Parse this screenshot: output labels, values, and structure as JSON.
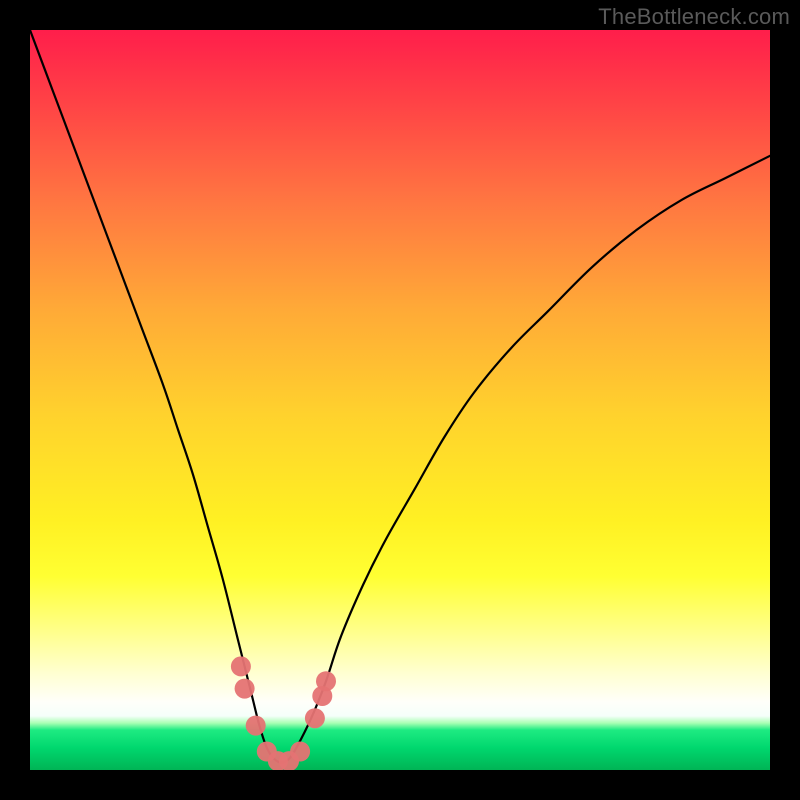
{
  "watermark": "TheBottleneck.com",
  "chart_data": {
    "type": "line",
    "title": "",
    "xlabel": "",
    "ylabel": "",
    "xlim": [
      0,
      100
    ],
    "ylim": [
      0,
      100
    ],
    "series": [
      {
        "name": "bottleneck-curve",
        "x": [
          0,
          3,
          6,
          9,
          12,
          15,
          18,
          20,
          22,
          24,
          26,
          28,
          30,
          31,
          32,
          33,
          34,
          35,
          36,
          38,
          40,
          42,
          45,
          48,
          52,
          56,
          60,
          65,
          70,
          76,
          82,
          88,
          94,
          100
        ],
        "y": [
          100,
          92,
          84,
          76,
          68,
          60,
          52,
          46,
          40,
          33,
          26,
          18,
          10,
          6,
          3,
          1.5,
          1,
          1.5,
          3,
          7,
          12,
          18,
          25,
          31,
          38,
          45,
          51,
          57,
          62,
          68,
          73,
          77,
          80,
          83
        ]
      }
    ],
    "markers": {
      "name": "highlighted-points",
      "points": [
        {
          "x": 28.5,
          "y": 14
        },
        {
          "x": 29.0,
          "y": 11
        },
        {
          "x": 30.5,
          "y": 6
        },
        {
          "x": 32.0,
          "y": 2.5
        },
        {
          "x": 33.5,
          "y": 1.2
        },
        {
          "x": 35.0,
          "y": 1.2
        },
        {
          "x": 36.5,
          "y": 2.5
        },
        {
          "x": 38.5,
          "y": 7
        },
        {
          "x": 39.5,
          "y": 10
        },
        {
          "x": 40.0,
          "y": 12
        }
      ]
    },
    "background_gradient": {
      "direction": "top-to-bottom",
      "stops": [
        {
          "pos": 0.0,
          "color": "#ff1e4b"
        },
        {
          "pos": 0.25,
          "color": "#ff7841"
        },
        {
          "pos": 0.55,
          "color": "#ffd22d"
        },
        {
          "pos": 0.78,
          "color": "#ffff32"
        },
        {
          "pos": 0.92,
          "color": "#ffffd2"
        },
        {
          "pos": 0.99,
          "color": "#aaffb4"
        },
        {
          "pos": 1.0,
          "color": "#00b455"
        }
      ]
    }
  }
}
